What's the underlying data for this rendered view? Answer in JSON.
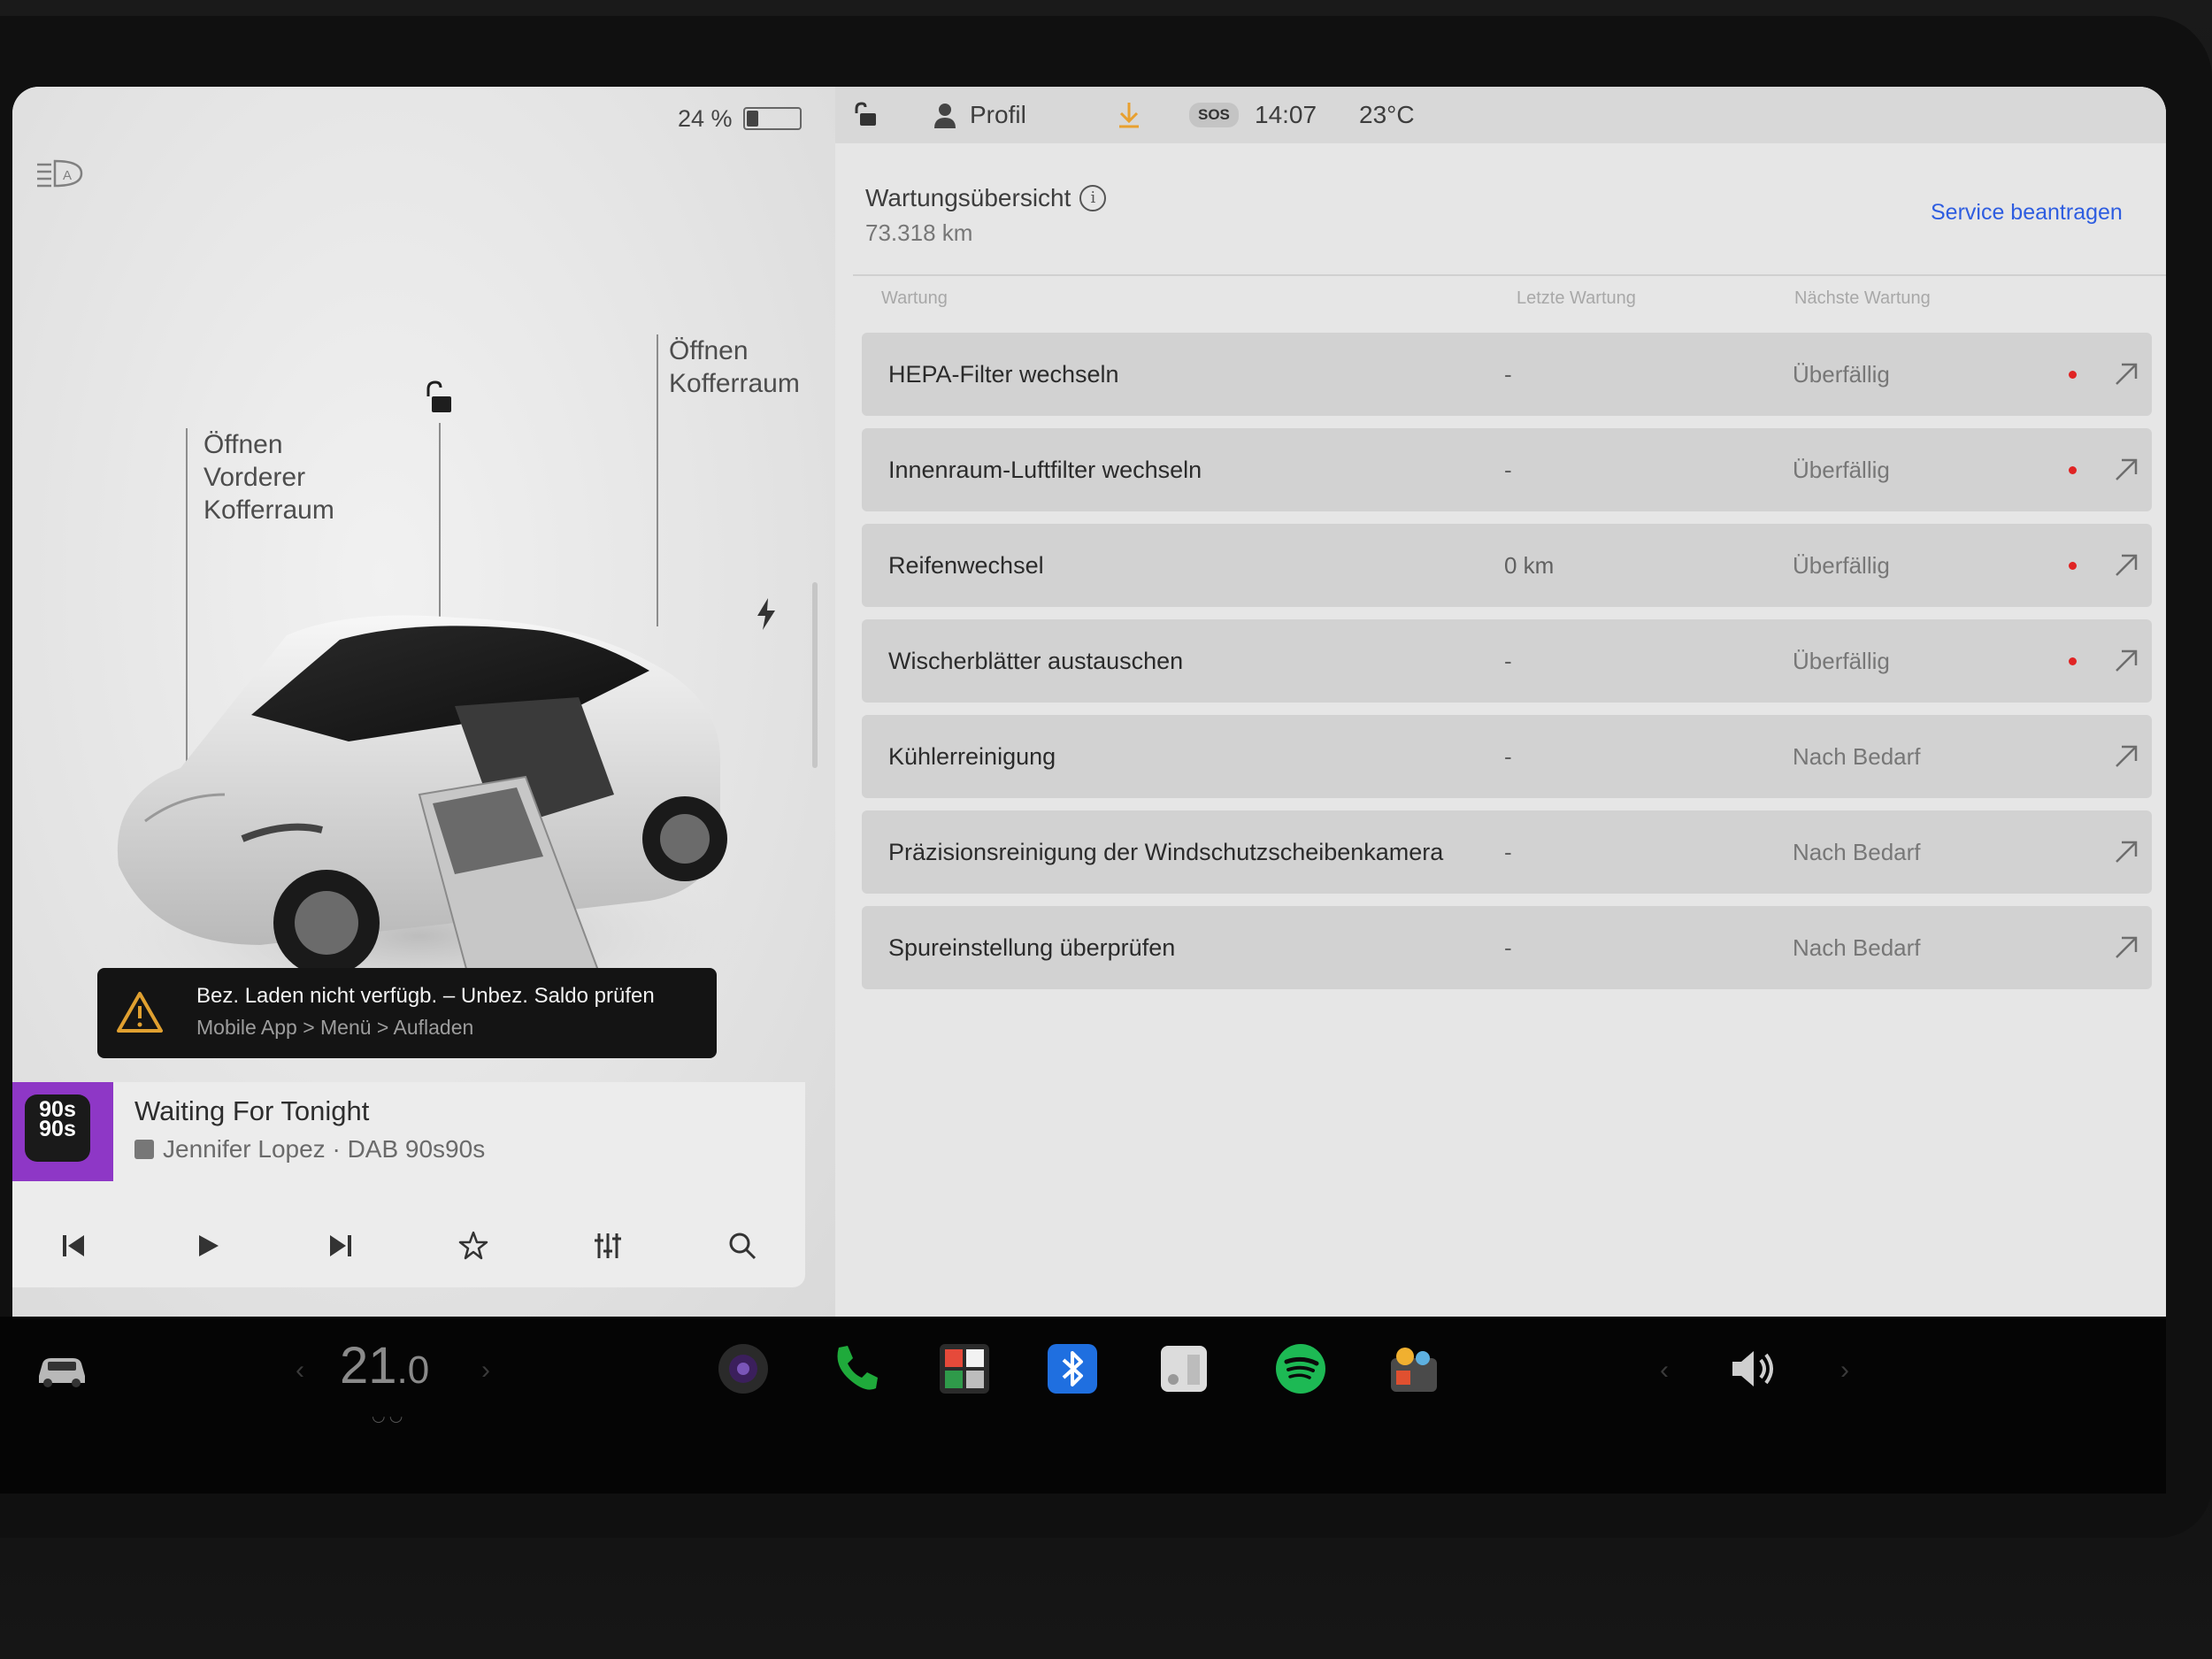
{
  "status": {
    "battery_label": "24 %",
    "battery_level": 0.24,
    "profile_label": "Profil",
    "sos_label": "SOS",
    "time": "14:07",
    "temperature": "23°C"
  },
  "car": {
    "front_trunk_label": "Öffnen\nVorderer\nKofferraum",
    "rear_trunk_label": "Öffnen\nKofferraum"
  },
  "warning": {
    "title": "Bez. Laden nicht verfügb. – Unbez. Saldo prüfen",
    "subtitle": "Mobile App > Menü > Aufladen"
  },
  "media": {
    "album_text": "90s\n90s",
    "title": "Waiting For Tonight",
    "subtitle": "Jennifer Lopez · DAB 90s90s"
  },
  "maintenance": {
    "title": "Wartungsübersicht",
    "mileage": "73.318  km",
    "service_link": "Service beantragen",
    "columns": [
      "Wartung",
      "Letzte Wartung",
      "Nächste Wartung"
    ],
    "rows": [
      {
        "name": "HEPA-Filter wechseln",
        "last": "-",
        "next": "Überfällig",
        "overdue": true
      },
      {
        "name": "Innenraum-Luftfilter wechseln",
        "last": "-",
        "next": "Überfällig",
        "overdue": true
      },
      {
        "name": "Reifenwechsel",
        "last": "0 km",
        "next": "Überfällig",
        "overdue": true
      },
      {
        "name": "Wischerblätter austauschen",
        "last": "-",
        "next": "Überfällig",
        "overdue": true
      },
      {
        "name": "Kühlerreinigung",
        "last": "-",
        "next": "Nach Bedarf",
        "overdue": false
      },
      {
        "name": "Präzisionsreinigung der Windschutzscheibenkamera",
        "last": "-",
        "next": "Nach Bedarf",
        "overdue": false
      },
      {
        "name": "Spureinstellung überprüfen",
        "last": "-",
        "next": "Nach Bedarf",
        "overdue": false
      }
    ]
  },
  "dock": {
    "temperature_main": "21",
    "temperature_decimal": ".0"
  },
  "colors": {
    "accent_blue": "#2e5de0",
    "overdue_red": "#e02424",
    "spotify_green": "#1db954",
    "phone_green": "#1faa3b",
    "bluetooth_blue": "#1f6fe0"
  }
}
